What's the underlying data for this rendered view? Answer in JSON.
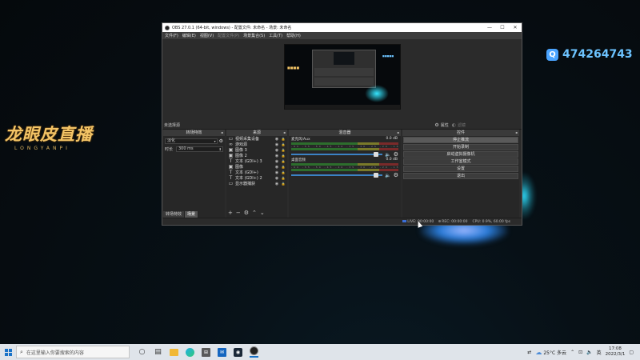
{
  "desktop": {
    "logo_main": "龙眼皮直播",
    "logo_sub": "LONGYANPI",
    "qq_number": "474264743"
  },
  "obs": {
    "title": "OBS 27.0.1 (64-bit, windows) - 配置文件: 未命名 - 场景: 未命名",
    "menu": [
      "文件(F)",
      "编辑(E)",
      "视图(V)",
      "配置文件(P)",
      "场景集合(S)",
      "工具(T)",
      "帮助(H)"
    ],
    "menu_dim_index": 3,
    "scene_header": {
      "label": "未选择源",
      "properties": "属性",
      "filters": "滤镜"
    },
    "docks": {
      "transitions_title": "转场特效",
      "sources_title": "来源",
      "mixer_title": "混音器",
      "controls_title": "控件"
    },
    "transitions": {
      "selected": "淡化",
      "duration_label": "时长",
      "duration_value": "300 ms"
    },
    "tabs": [
      "转场特效",
      "场景"
    ],
    "sources": [
      {
        "icon": "video-capture-icon",
        "glyph": "▭",
        "name": "视频采集设备"
      },
      {
        "icon": "browser-icon",
        "glyph": "∞",
        "name": "游戏源"
      },
      {
        "icon": "image-icon",
        "glyph": "▣",
        "name": "图像 3"
      },
      {
        "icon": "image-icon",
        "glyph": "▣",
        "name": "图像 2"
      },
      {
        "icon": "text-icon",
        "glyph": "T",
        "name": "文本 (GDI+) 3"
      },
      {
        "icon": "image-icon",
        "glyph": "▣",
        "name": "图像"
      },
      {
        "icon": "text-icon",
        "glyph": "T",
        "name": "文本 (GDI+)"
      },
      {
        "icon": "text-icon",
        "glyph": "T",
        "name": "文本 (GDI+) 2"
      },
      {
        "icon": "display-capture-icon",
        "glyph": "▭",
        "name": "显示器捕获"
      }
    ],
    "mixer": [
      {
        "name": "麦克风/Aux",
        "db": "0.0 dB",
        "level": 0.95
      },
      {
        "name": "桌面音频",
        "db": "0.0 dB",
        "level": 0.95
      }
    ],
    "meter_ticks": "-60 -55 -50 -45 -40 -35 -30 -25 -20 -15 -10 -5 0",
    "controls": [
      "停止推流",
      "开始录制",
      "启动虚拟摄像机",
      "工作室模式",
      "设置",
      "退出"
    ],
    "controls_active_index": 0,
    "status": {
      "live": "LIVE: 00:00:00",
      "rec": "REC: 00:00:00",
      "cpu": "CPU: 0.9%, 60.00 fps"
    }
  },
  "taskbar": {
    "search_placeholder": "在这里输入你要搜索的内容",
    "weather": "25°C 多云",
    "time": "17:08",
    "date": "2022/3/1"
  }
}
